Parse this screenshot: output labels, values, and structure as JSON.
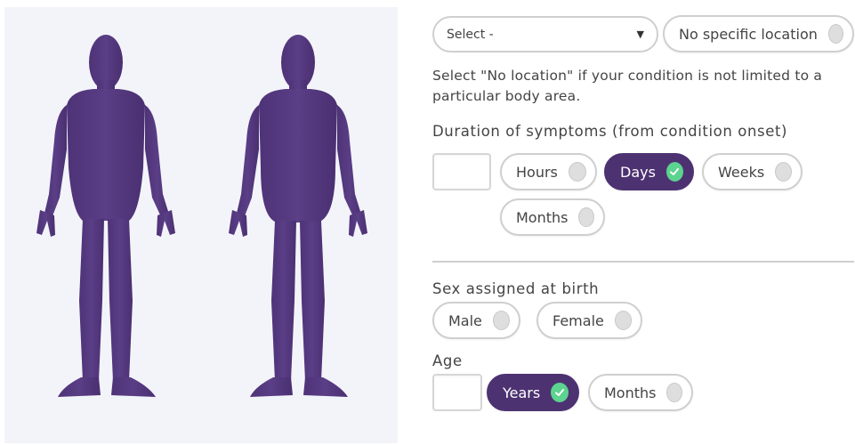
{
  "location": {
    "select_label": "Select -",
    "no_location_label": "No specific location",
    "help_text": "Select \"No location\" if your condition is not limited to a particular body area."
  },
  "duration": {
    "title": "Duration of symptoms (from condition onset)",
    "value": "",
    "options": [
      "Hours",
      "Days",
      "Weeks",
      "Months"
    ],
    "selected": "Days"
  },
  "sex": {
    "title": "Sex assigned at birth",
    "options": [
      "Male",
      "Female"
    ]
  },
  "age": {
    "title": "Age",
    "value": "",
    "options": [
      "Years",
      "Months"
    ],
    "selected": "Years"
  },
  "colors": {
    "accent": "#4d3272",
    "check": "#5cd38e",
    "panel": "#f3f4f9"
  }
}
